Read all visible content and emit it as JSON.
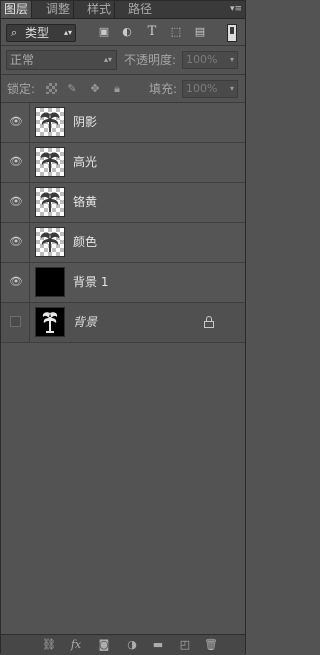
{
  "tabs": [
    "图层",
    "调整",
    "样式",
    "路径"
  ],
  "panel_menu_icon": "panel-menu-icon",
  "filter": {
    "label": "类型",
    "icons": [
      "image-filter-icon",
      "adjustment-filter-icon",
      "text-filter-icon",
      "shape-filter-icon",
      "smart-object-filter-icon"
    ]
  },
  "blend": {
    "mode": "正常",
    "opacity_label": "不透明度:",
    "opacity": "100%"
  },
  "lock": {
    "label": "锁定:",
    "icons": [
      "lock-transparency-icon",
      "lock-pixels-icon",
      "lock-position-icon",
      "lock-all-icon"
    ]
  },
  "fill": {
    "label": "填充:",
    "value": "100%"
  },
  "layers": [
    {
      "name": "阴影",
      "visible": true,
      "thumb": "checker"
    },
    {
      "name": "高光",
      "visible": true,
      "thumb": "checker"
    },
    {
      "name": "铬黄",
      "visible": true,
      "thumb": "checker"
    },
    {
      "name": "颜色",
      "visible": true,
      "thumb": "checker"
    },
    {
      "name": "背景 1",
      "visible": true,
      "thumb": "black"
    },
    {
      "name": "背景",
      "visible": false,
      "thumb": "image",
      "locked": true
    }
  ],
  "footer_icons": [
    "link-layers-icon",
    "fx-icon",
    "mask-icon",
    "adjustment-layer-icon",
    "group-folder-icon",
    "new-layer-icon",
    "trash-icon"
  ],
  "text": {
    "fx": "fx",
    "text_filter": "T"
  }
}
